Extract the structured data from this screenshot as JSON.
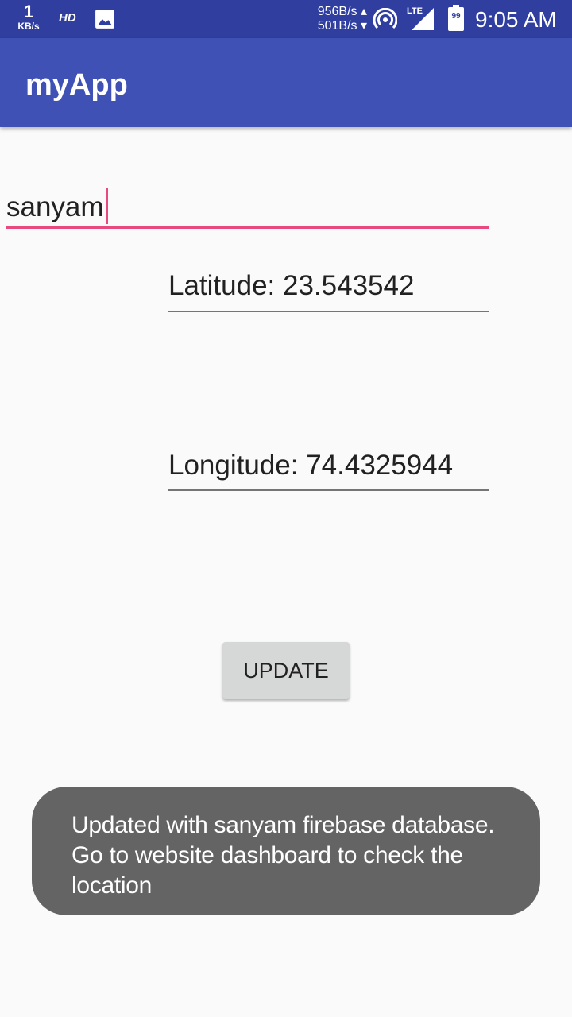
{
  "status_bar": {
    "speed_value": "1",
    "speed_unit": "KB/s",
    "hd": "HD",
    "upload": "956B/s ▴",
    "download": "501B/s ▾",
    "lte": "LTE",
    "battery": "99",
    "time": "9:05 AM"
  },
  "app_bar": {
    "title": "myApp"
  },
  "form": {
    "name_value": "sanyam",
    "latitude": "Latitude: 23.543542",
    "longitude": "Longitude: 74.4325944",
    "update_label": "UPDATE"
  },
  "toast": {
    "message": "Updated with sanyam firebase database. Go to website dashboard to check the location"
  },
  "colors": {
    "status_bar": "#303f9f",
    "app_bar": "#3f51b5",
    "accent": "#e84a7f",
    "toast_bg": "#646464"
  }
}
